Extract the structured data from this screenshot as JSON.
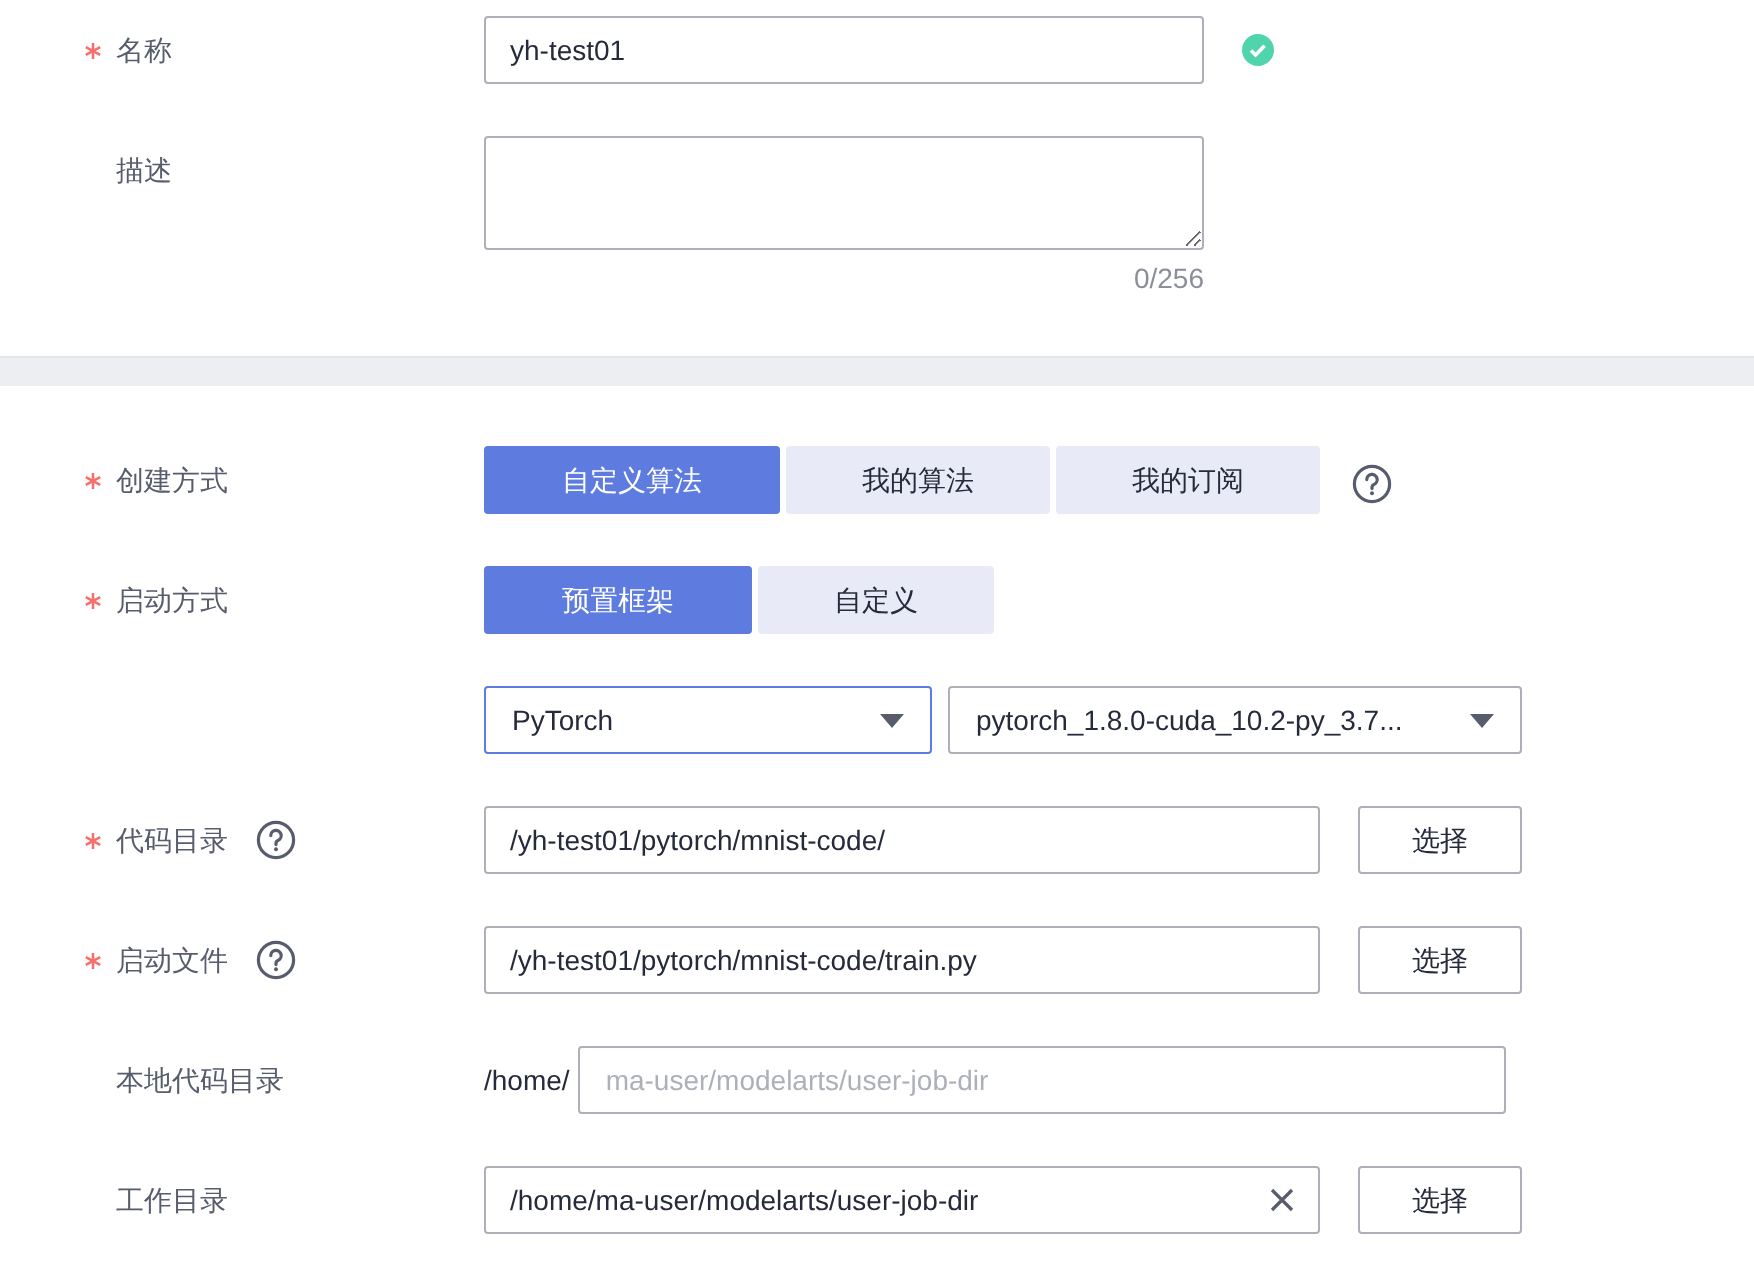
{
  "sections": [
    {
      "rows": [
        {
          "kind": "text",
          "label": "名称",
          "required": true,
          "help": false,
          "value": "yh-test01",
          "valid": true
        },
        {
          "kind": "textarea",
          "label": "描述",
          "required": false,
          "help": false,
          "counter": "0/256"
        }
      ]
    },
    {
      "rows": [
        {
          "kind": "segmented",
          "label": "创建方式",
          "required": true,
          "help": false,
          "trailing_help": true,
          "options": [
            {
              "label": "自定义算法",
              "selected": true
            },
            {
              "label": "我的算法",
              "selected": false
            },
            {
              "label": "我的订阅",
              "selected": false
            }
          ]
        },
        {
          "kind": "segmented",
          "label": "启动方式",
          "required": true,
          "help": false,
          "trailing_help": false,
          "options": [
            {
              "label": "预置框架",
              "selected": true
            },
            {
              "label": "自定义",
              "selected": false
            }
          ]
        },
        {
          "kind": "selects",
          "selects": [
            {
              "value": "PyTorch",
              "focused": true
            },
            {
              "value": "pytorch_1.8.0-cuda_10.2-py_3.7...",
              "focused": false
            }
          ]
        },
        {
          "kind": "path",
          "label": "代码目录",
          "required": true,
          "help": true,
          "value": "/yh-test01/pytorch/mnist-code/",
          "clearable": false,
          "button": "选择"
        },
        {
          "kind": "path",
          "label": "启动文件",
          "required": true,
          "help": true,
          "value": "/yh-test01/pytorch/mnist-code/train.py",
          "clearable": false,
          "button": "选择"
        },
        {
          "kind": "prefixed",
          "label": "本地代码目录",
          "required": false,
          "help": false,
          "prefix": "/home/",
          "placeholder": "ma-user/modelarts/user-job-dir"
        },
        {
          "kind": "path",
          "label": "工作目录",
          "required": false,
          "help": false,
          "value": "/home/ma-user/modelarts/user-job-dir",
          "clearable": true,
          "button": "选择"
        }
      ]
    }
  ]
}
